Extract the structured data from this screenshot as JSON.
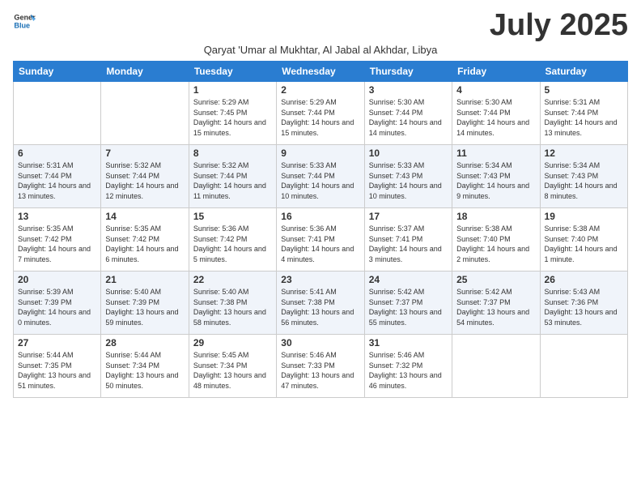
{
  "logo": {
    "line1": "General",
    "line2": "Blue"
  },
  "title": "July 2025",
  "subtitle": "Qaryat 'Umar al Mukhtar, Al Jabal al Akhdar, Libya",
  "days_header": [
    "Sunday",
    "Monday",
    "Tuesday",
    "Wednesday",
    "Thursday",
    "Friday",
    "Saturday"
  ],
  "weeks": [
    [
      {
        "day": "",
        "info": ""
      },
      {
        "day": "",
        "info": ""
      },
      {
        "day": "1",
        "info": "Sunrise: 5:29 AM\nSunset: 7:45 PM\nDaylight: 14 hours and 15 minutes."
      },
      {
        "day": "2",
        "info": "Sunrise: 5:29 AM\nSunset: 7:44 PM\nDaylight: 14 hours and 15 minutes."
      },
      {
        "day": "3",
        "info": "Sunrise: 5:30 AM\nSunset: 7:44 PM\nDaylight: 14 hours and 14 minutes."
      },
      {
        "day": "4",
        "info": "Sunrise: 5:30 AM\nSunset: 7:44 PM\nDaylight: 14 hours and 14 minutes."
      },
      {
        "day": "5",
        "info": "Sunrise: 5:31 AM\nSunset: 7:44 PM\nDaylight: 14 hours and 13 minutes."
      }
    ],
    [
      {
        "day": "6",
        "info": "Sunrise: 5:31 AM\nSunset: 7:44 PM\nDaylight: 14 hours and 13 minutes."
      },
      {
        "day": "7",
        "info": "Sunrise: 5:32 AM\nSunset: 7:44 PM\nDaylight: 14 hours and 12 minutes."
      },
      {
        "day": "8",
        "info": "Sunrise: 5:32 AM\nSunset: 7:44 PM\nDaylight: 14 hours and 11 minutes."
      },
      {
        "day": "9",
        "info": "Sunrise: 5:33 AM\nSunset: 7:44 PM\nDaylight: 14 hours and 10 minutes."
      },
      {
        "day": "10",
        "info": "Sunrise: 5:33 AM\nSunset: 7:43 PM\nDaylight: 14 hours and 10 minutes."
      },
      {
        "day": "11",
        "info": "Sunrise: 5:34 AM\nSunset: 7:43 PM\nDaylight: 14 hours and 9 minutes."
      },
      {
        "day": "12",
        "info": "Sunrise: 5:34 AM\nSunset: 7:43 PM\nDaylight: 14 hours and 8 minutes."
      }
    ],
    [
      {
        "day": "13",
        "info": "Sunrise: 5:35 AM\nSunset: 7:42 PM\nDaylight: 14 hours and 7 minutes."
      },
      {
        "day": "14",
        "info": "Sunrise: 5:35 AM\nSunset: 7:42 PM\nDaylight: 14 hours and 6 minutes."
      },
      {
        "day": "15",
        "info": "Sunrise: 5:36 AM\nSunset: 7:42 PM\nDaylight: 14 hours and 5 minutes."
      },
      {
        "day": "16",
        "info": "Sunrise: 5:36 AM\nSunset: 7:41 PM\nDaylight: 14 hours and 4 minutes."
      },
      {
        "day": "17",
        "info": "Sunrise: 5:37 AM\nSunset: 7:41 PM\nDaylight: 14 hours and 3 minutes."
      },
      {
        "day": "18",
        "info": "Sunrise: 5:38 AM\nSunset: 7:40 PM\nDaylight: 14 hours and 2 minutes."
      },
      {
        "day": "19",
        "info": "Sunrise: 5:38 AM\nSunset: 7:40 PM\nDaylight: 14 hours and 1 minute."
      }
    ],
    [
      {
        "day": "20",
        "info": "Sunrise: 5:39 AM\nSunset: 7:39 PM\nDaylight: 14 hours and 0 minutes."
      },
      {
        "day": "21",
        "info": "Sunrise: 5:40 AM\nSunset: 7:39 PM\nDaylight: 13 hours and 59 minutes."
      },
      {
        "day": "22",
        "info": "Sunrise: 5:40 AM\nSunset: 7:38 PM\nDaylight: 13 hours and 58 minutes."
      },
      {
        "day": "23",
        "info": "Sunrise: 5:41 AM\nSunset: 7:38 PM\nDaylight: 13 hours and 56 minutes."
      },
      {
        "day": "24",
        "info": "Sunrise: 5:42 AM\nSunset: 7:37 PM\nDaylight: 13 hours and 55 minutes."
      },
      {
        "day": "25",
        "info": "Sunrise: 5:42 AM\nSunset: 7:37 PM\nDaylight: 13 hours and 54 minutes."
      },
      {
        "day": "26",
        "info": "Sunrise: 5:43 AM\nSunset: 7:36 PM\nDaylight: 13 hours and 53 minutes."
      }
    ],
    [
      {
        "day": "27",
        "info": "Sunrise: 5:44 AM\nSunset: 7:35 PM\nDaylight: 13 hours and 51 minutes."
      },
      {
        "day": "28",
        "info": "Sunrise: 5:44 AM\nSunset: 7:34 PM\nDaylight: 13 hours and 50 minutes."
      },
      {
        "day": "29",
        "info": "Sunrise: 5:45 AM\nSunset: 7:34 PM\nDaylight: 13 hours and 48 minutes."
      },
      {
        "day": "30",
        "info": "Sunrise: 5:46 AM\nSunset: 7:33 PM\nDaylight: 13 hours and 47 minutes."
      },
      {
        "day": "31",
        "info": "Sunrise: 5:46 AM\nSunset: 7:32 PM\nDaylight: 13 hours and 46 minutes."
      },
      {
        "day": "",
        "info": ""
      },
      {
        "day": "",
        "info": ""
      }
    ]
  ]
}
